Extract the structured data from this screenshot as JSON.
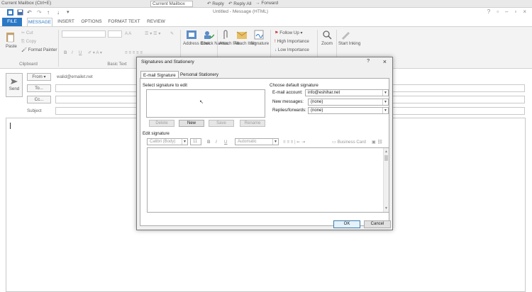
{
  "topstrip": {
    "left_text": "Current Mailbox (Ctrl+E)",
    "mailbox": "Current Mailbox",
    "reply": "Reply",
    "reply_all": "Reply All",
    "forward": "Forward"
  },
  "window": {
    "title": "Untitled - Message (HTML)",
    "controls": [
      "?",
      "▫",
      "–",
      "▫",
      "×"
    ]
  },
  "tabs": [
    "FILE",
    "MESSAGE",
    "INSERT",
    "OPTIONS",
    "FORMAT TEXT",
    "REVIEW"
  ],
  "ribbon": {
    "clipboard": {
      "paste": "Paste",
      "cut": "Cut",
      "copy": "Copy",
      "format_painter": "Format Painter",
      "label": "Clipboard"
    },
    "basic_text": {
      "label": "Basic Text"
    },
    "names": {
      "address_book": "Address Book",
      "check_names": "Check Names"
    },
    "include": {
      "attach_file": "Attach File",
      "attach_item": "Attach Item",
      "signature": "Signature"
    },
    "tags": {
      "follow_up": "Follow Up",
      "high": "High Importance",
      "low": "Low Importance"
    },
    "zoom": "Zoom",
    "start_inking": "Start Inking"
  },
  "header": {
    "from_btn": "From",
    "from_value": "walid@emailet.net",
    "send": "Send",
    "to": "To...",
    "cc": "Cc...",
    "subject": "Subject"
  },
  "dialog": {
    "title": "Signatures and Stationery",
    "help": "?",
    "close": "×",
    "tabs": [
      "E-mail Signature",
      "Personal Stationery"
    ],
    "select_label": "Select signature to edit",
    "buttons": [
      "Delete",
      "New",
      "Save",
      "Rename"
    ],
    "default_label": "Choose default signature",
    "email_account_label": "E-mail account:",
    "email_account_value": "info@eshihar.net",
    "new_messages_label": "New messages:",
    "new_messages_value": "(none)",
    "replies_label": "Replies/forwards:",
    "replies_value": "(none)",
    "edit_label": "Edit signature",
    "font": "Calibri (Body)",
    "size": "11",
    "color": "Automatic",
    "business_card": "Business Card",
    "ok": "OK",
    "cancel": "Cancel"
  }
}
